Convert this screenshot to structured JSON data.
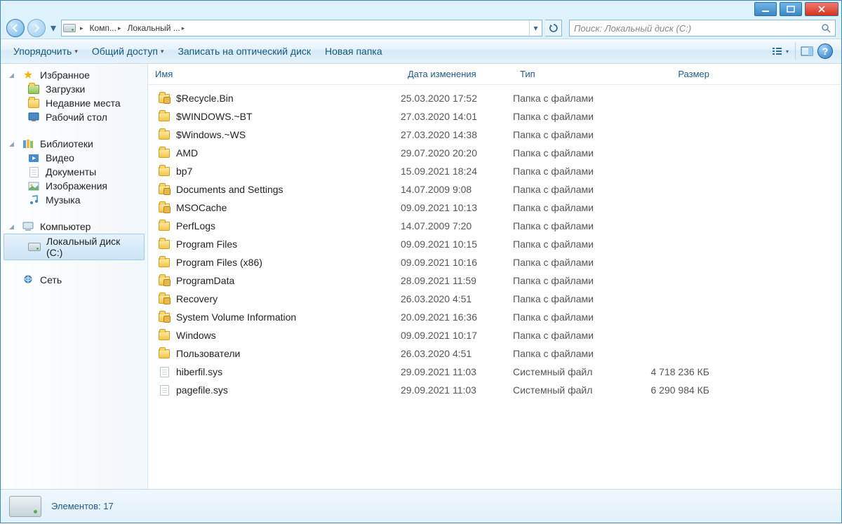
{
  "breadcrumb": {
    "seg1": "Комп...",
    "seg2": "Локальный ..."
  },
  "search": {
    "placeholder": "Поиск: Локальный диск (C:)"
  },
  "toolbar": {
    "organize": "Упорядочить",
    "share": "Общий доступ",
    "burn": "Записать на оптический диск",
    "newfolder": "Новая папка"
  },
  "sidebar": {
    "favorites": "Избранное",
    "downloads": "Загрузки",
    "recent": "Недавние места",
    "desktop": "Рабочий стол",
    "libraries": "Библиотеки",
    "video": "Видео",
    "documents": "Документы",
    "pictures": "Изображения",
    "music": "Музыка",
    "computer": "Компьютер",
    "localdisk": "Локальный диск (C:)",
    "network": "Сеть"
  },
  "columns": {
    "name": "Имя",
    "date": "Дата изменения",
    "type": "Тип",
    "size": "Размер"
  },
  "files": [
    {
      "name": "$Recycle.Bin",
      "date": "25.03.2020 17:52",
      "type": "Папка с файлами",
      "size": "",
      "icon": "folder-lock"
    },
    {
      "name": "$WINDOWS.~BT",
      "date": "27.03.2020 14:01",
      "type": "Папка с файлами",
      "size": "",
      "icon": "folder"
    },
    {
      "name": "$Windows.~WS",
      "date": "27.03.2020 14:38",
      "type": "Папка с файлами",
      "size": "",
      "icon": "folder"
    },
    {
      "name": "AMD",
      "date": "29.07.2020 20:20",
      "type": "Папка с файлами",
      "size": "",
      "icon": "folder"
    },
    {
      "name": "bp7",
      "date": "15.09.2021 18:24",
      "type": "Папка с файлами",
      "size": "",
      "icon": "folder"
    },
    {
      "name": "Documents and Settings",
      "date": "14.07.2009 9:08",
      "type": "Папка с файлами",
      "size": "",
      "icon": "folder-lock"
    },
    {
      "name": "MSOCache",
      "date": "09.09.2021 10:13",
      "type": "Папка с файлами",
      "size": "",
      "icon": "folder-lock"
    },
    {
      "name": "PerfLogs",
      "date": "14.07.2009 7:20",
      "type": "Папка с файлами",
      "size": "",
      "icon": "folder"
    },
    {
      "name": "Program Files",
      "date": "09.09.2021 10:15",
      "type": "Папка с файлами",
      "size": "",
      "icon": "folder"
    },
    {
      "name": "Program Files (x86)",
      "date": "09.09.2021 10:16",
      "type": "Папка с файлами",
      "size": "",
      "icon": "folder"
    },
    {
      "name": "ProgramData",
      "date": "28.09.2021 11:59",
      "type": "Папка с файлами",
      "size": "",
      "icon": "folder-lock"
    },
    {
      "name": "Recovery",
      "date": "26.03.2020 4:51",
      "type": "Папка с файлами",
      "size": "",
      "icon": "folder-lock"
    },
    {
      "name": "System Volume Information",
      "date": "20.09.2021 16:36",
      "type": "Папка с файлами",
      "size": "",
      "icon": "folder-lock"
    },
    {
      "name": "Windows",
      "date": "09.09.2021 10:17",
      "type": "Папка с файлами",
      "size": "",
      "icon": "folder"
    },
    {
      "name": "Пользователи",
      "date": "26.03.2020 4:51",
      "type": "Папка с файлами",
      "size": "",
      "icon": "folder"
    },
    {
      "name": "hiberfil.sys",
      "date": "29.09.2021 11:03",
      "type": "Системный файл",
      "size": "4 718 236 КБ",
      "icon": "file"
    },
    {
      "name": "pagefile.sys",
      "date": "29.09.2021 11:03",
      "type": "Системный файл",
      "size": "6 290 984 КБ",
      "icon": "file"
    }
  ],
  "status": {
    "count": "Элементов: 17"
  }
}
